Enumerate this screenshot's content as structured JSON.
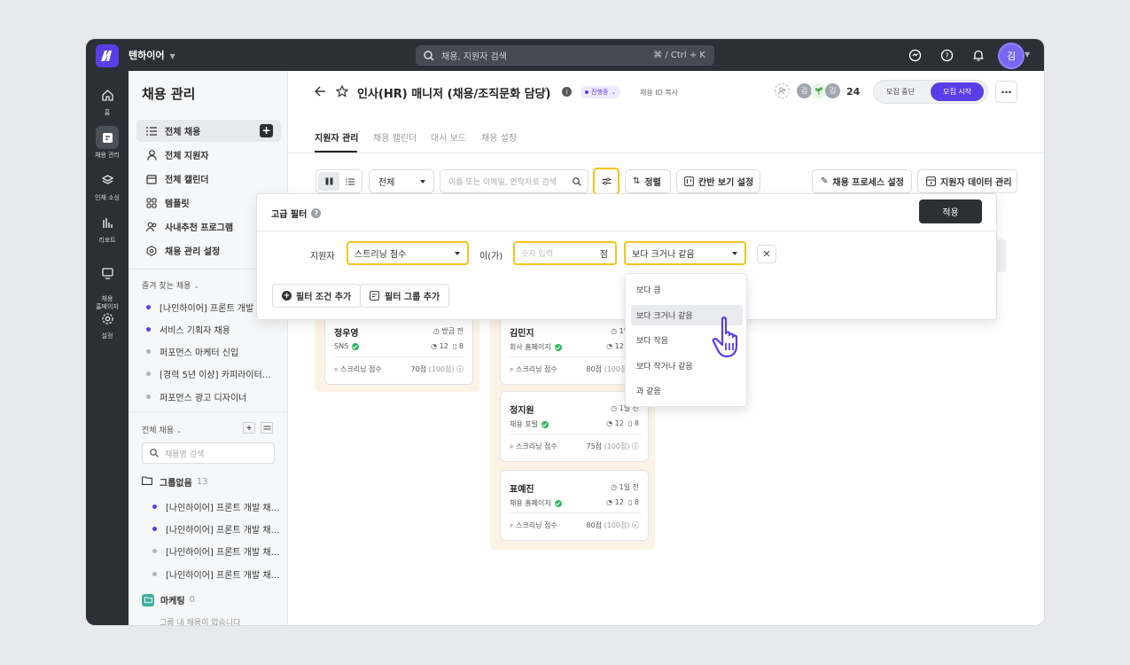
{
  "topbar": {
    "brand": "텐하이어",
    "search_placeholder": "채용, 지원자 검색",
    "shortcut": "⌘ / Ctrl + K",
    "user_avatar": "김",
    "icons": [
      "chat-icon",
      "help-icon",
      "bell-icon"
    ]
  },
  "rail": {
    "items": [
      {
        "label": "홈",
        "icon": "home-icon"
      },
      {
        "label": "채용 관리",
        "icon": "recruit-icon"
      },
      {
        "label": "인재 소싱",
        "icon": "layers-icon"
      },
      {
        "label": "리포트",
        "icon": "chart-icon"
      },
      {
        "label": "채용\n홈페이지",
        "icon": "monitor-icon"
      },
      {
        "label": "설정",
        "icon": "gear-icon"
      }
    ]
  },
  "sidebar": {
    "title": "채용 관리",
    "menu": [
      {
        "label": "전체 채용"
      },
      {
        "label": "전체 지원자"
      },
      {
        "label": "전체 캘린더"
      },
      {
        "label": "템플릿"
      },
      {
        "label": "사내추천 프로그램"
      },
      {
        "label": "채용 관리 설정"
      }
    ],
    "favorites_head": "즐겨 찾는 채용",
    "favorites": [
      {
        "label": "[나인하이어] 프론트 개발 채…",
        "color": "#5b3de8"
      },
      {
        "label": "서비스 기획자 채용",
        "color": "#5b3de8"
      },
      {
        "label": "퍼포먼스 마케터 신입",
        "color": "#b0b3b8"
      },
      {
        "label": "[경력 5년 이상] 카피라이터…",
        "color": "#b0b3b8"
      },
      {
        "label": "퍼포먼스 광고 디자이너",
        "color": "#b0b3b8"
      }
    ],
    "all_head": "전체 채용",
    "search_placeholder": "채용명 검색",
    "group_none": {
      "label": "그룹없음",
      "count": "13"
    },
    "group_items": [
      {
        "label": "[나인하이어] 프론트 개발 채…",
        "color": "#5b3de8"
      },
      {
        "label": "[나인하이어] 프론트 개발 채…",
        "color": "#5b3de8"
      },
      {
        "label": "[나인하이어] 프론트 개발 채…",
        "color": "#b0b3b8"
      },
      {
        "label": "[나인하이어] 프론트 개발 채…",
        "color": "#b0b3b8"
      }
    ],
    "group_marketing": {
      "label": "마케팅",
      "count": "0"
    },
    "empty_text": "그룹 내 채용이 없습니다"
  },
  "header": {
    "title": "인사(HR) 매니저 (채용/조직문화 담당)",
    "status": "진행중",
    "copy_id": "채용 ID 복사",
    "member_avatars": [
      "김",
      "김"
    ],
    "member_count": "24",
    "stop_label": "모집 중단",
    "start_label": "모집 시작"
  },
  "tabs": [
    "지원자 관리",
    "채용 캘린더",
    "대시 보드",
    "채용 설정"
  ],
  "toolbar": {
    "stage_select": "전체",
    "search_placeholder": "이름 또는 이메일, 연락처로 검색",
    "sort_label": "정렬",
    "kanban_label": "칸반 보기 설정",
    "process_label": "채용 프로세스 설정",
    "data_label": "지원자 데이터 관리"
  },
  "filter_panel": {
    "title": "고급 필터",
    "apply_label": "적용",
    "subject_label": "지원자",
    "field_value": "스트리닝 점수",
    "particle": "이(가)",
    "number_placeholder": "숫자 입력",
    "unit": "점",
    "operator_value": "보다 크거나 같음",
    "add_condition": "필터 조건 추가",
    "add_group": "필터 그룹 추가"
  },
  "operator_options": [
    "보다 큼",
    "보다 크거나 같음",
    "보다 작음",
    "보다 작거나 같음",
    "과 같음"
  ],
  "cards": [
    {
      "name": "정우영",
      "time": "방금 전",
      "source": "SNS",
      "comments": "12",
      "files": "8",
      "score_label": "스크리닝 점수",
      "score": "70점",
      "max": "(100점)"
    },
    {
      "name": "김민지",
      "time": "1일 전",
      "source": "회사 홈페이지",
      "comments": "12",
      "files": "8",
      "score_label": "스크리닝 점수",
      "score": "80점",
      "max": "(100점)"
    },
    {
      "name": "정지원",
      "time": "1일 전",
      "source": "채용 포털",
      "comments": "12",
      "files": "8",
      "score_label": "스크리닝 점수",
      "score": "75점",
      "max": "(100점)"
    },
    {
      "name": "표예진",
      "time": "1일 전",
      "source": "채용 홈페이지",
      "comments": "12",
      "files": "8",
      "score_label": "스크리닝 점수",
      "score": "80점",
      "max": "(100점)"
    }
  ],
  "colors": {
    "accent": "#5b3de8",
    "highlight": "#f5c518",
    "dark": "#2b3036",
    "kanban_bg": "#fdf2e6"
  }
}
